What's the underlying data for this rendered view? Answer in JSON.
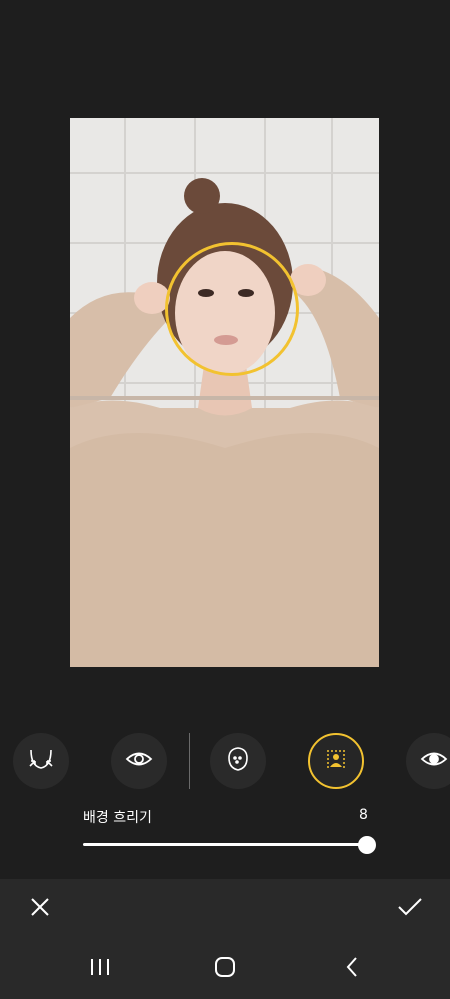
{
  "editor": {
    "blur_label": "배경 흐리기",
    "blur_value": "8",
    "blur_level_percent": 100
  },
  "colors": {
    "accent": "#f2c230",
    "background": "#1e1e1e",
    "bar": "#292929"
  },
  "tools": [
    {
      "icon": "jaw-slim-icon",
      "selected": false
    },
    {
      "icon": "eye-icon",
      "selected": false
    },
    {
      "icon": "face-spots-icon",
      "selected": false
    },
    {
      "icon": "background-blur-icon",
      "selected": true
    },
    {
      "icon": "eye-icon",
      "selected": false
    }
  ],
  "actions": {
    "cancel_icon": "close-icon",
    "confirm_icon": "check-icon"
  },
  "navigation": {
    "recents_icon": "recents-icon",
    "home_icon": "home-icon",
    "back_icon": "back-icon"
  }
}
